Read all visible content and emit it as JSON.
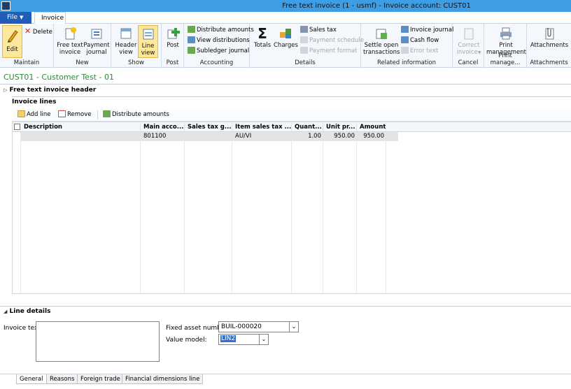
{
  "window": {
    "title": "Free text invoice (1 - usmf) - Invoice account: CUST01"
  },
  "tabs": {
    "file": "File",
    "invoice": "Invoice"
  },
  "ribbon": {
    "maintain": {
      "label": "Maintain",
      "edit": "Edit",
      "delete": "Delete"
    },
    "new": {
      "label": "New",
      "free_text": [
        "Free text",
        "invoice"
      ],
      "payment_journal": [
        "Payment",
        "journal"
      ]
    },
    "show": {
      "label": "Show",
      "header_view": [
        "Header",
        "view"
      ],
      "line_view": [
        "Line",
        "view"
      ]
    },
    "post": {
      "label": "Post",
      "post": "Post"
    },
    "accounting": {
      "label": "Accounting",
      "distribute": "Distribute amounts",
      "view_dist": "View distributions",
      "subledger": "Subledger journal"
    },
    "details": {
      "label": "Details",
      "totals": "Totals",
      "charges": "Charges",
      "sales_tax": "Sales tax",
      "payment_schedule": "Payment schedule",
      "payment_format": "Payment format"
    },
    "related": {
      "label": "Related information",
      "settle": [
        "Settle open",
        "transactions"
      ],
      "invoice_journal": "Invoice journal",
      "cash_flow": "Cash flow",
      "error_text": "Error text"
    },
    "cancel": {
      "label": "Cancel",
      "correct": [
        "Correct",
        "invoice"
      ]
    },
    "print": {
      "label": "Print manage...",
      "print_mgmt": [
        "Print",
        "management"
      ]
    },
    "attachments": {
      "label": "Attachments",
      "attachments": "Attachments"
    }
  },
  "page": {
    "heading": "CUST01 - Customer Test - 01",
    "header_section": "Free text invoice header",
    "lines_section": "Invoice lines"
  },
  "lines_toolbar": {
    "add": "Add line",
    "remove": "Remove",
    "distribute": "Distribute amounts"
  },
  "grid": {
    "columns": [
      "Description",
      "Main acco...",
      "Sales tax g...",
      "Item sales tax ...",
      "Quant...",
      "Unit pr...",
      "Amount"
    ],
    "rows": [
      {
        "description": "",
        "main_account": "801100",
        "sales_tax_group": "",
        "item_sales_tax": "AU/VI",
        "quantity": "1.00",
        "unit_price": "950.00",
        "amount": "950.00"
      }
    ]
  },
  "line_details": {
    "title": "Line details",
    "invoice_text_label": "Invoice text:",
    "fixed_asset_label": "Fixed asset number:",
    "fixed_asset_value": "BUIL-000020",
    "value_model_label": "Value model:",
    "value_model_value": "LIN2"
  },
  "bottom_tabs": [
    "General",
    "Reasons",
    "Foreign trade",
    "Financial dimensions line"
  ]
}
